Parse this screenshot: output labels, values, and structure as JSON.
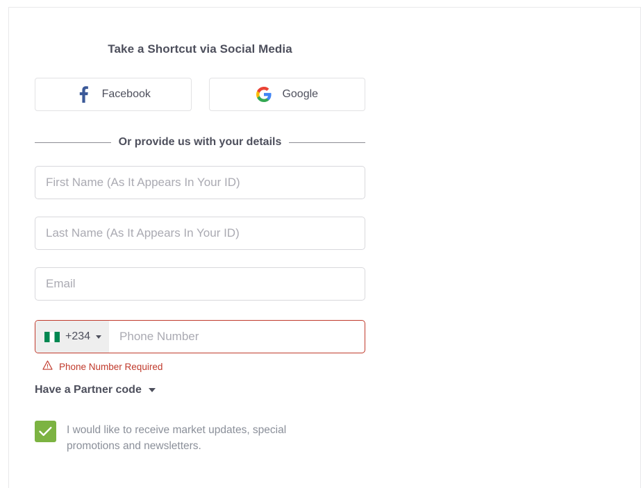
{
  "form": {
    "section_title": "Take a Shortcut via Social Media",
    "social_buttons": [
      {
        "label": "Facebook",
        "icon": "facebook-icon",
        "color": "#3b5998"
      },
      {
        "label": "Google",
        "icon": "google-icon",
        "color": "#4285f4"
      }
    ],
    "divider_text": "Or provide us with your details",
    "fields": [
      {
        "name": "first-name",
        "placeholder": "First Name (As It Appears In Your ID)",
        "value": ""
      },
      {
        "name": "last-name",
        "placeholder": "Last Name (As It Appears In Your ID)",
        "value": ""
      },
      {
        "name": "email",
        "placeholder": "Email",
        "value": ""
      }
    ],
    "phone": {
      "country_flag": "nigeria-flag",
      "country_code": "+234",
      "placeholder": "Phone Number",
      "value": "",
      "error": "Phone Number Required",
      "error_icon": "warning-triangle-icon",
      "error_color": "#c0392b"
    },
    "partner_code": {
      "label": "Have a Partner code",
      "expanded": false,
      "icon": "chevron-down-icon"
    },
    "newsletter": {
      "checked": true,
      "check_color": "#7cb342",
      "label": "I would like to receive market updates, special promotions and newsletters."
    }
  }
}
